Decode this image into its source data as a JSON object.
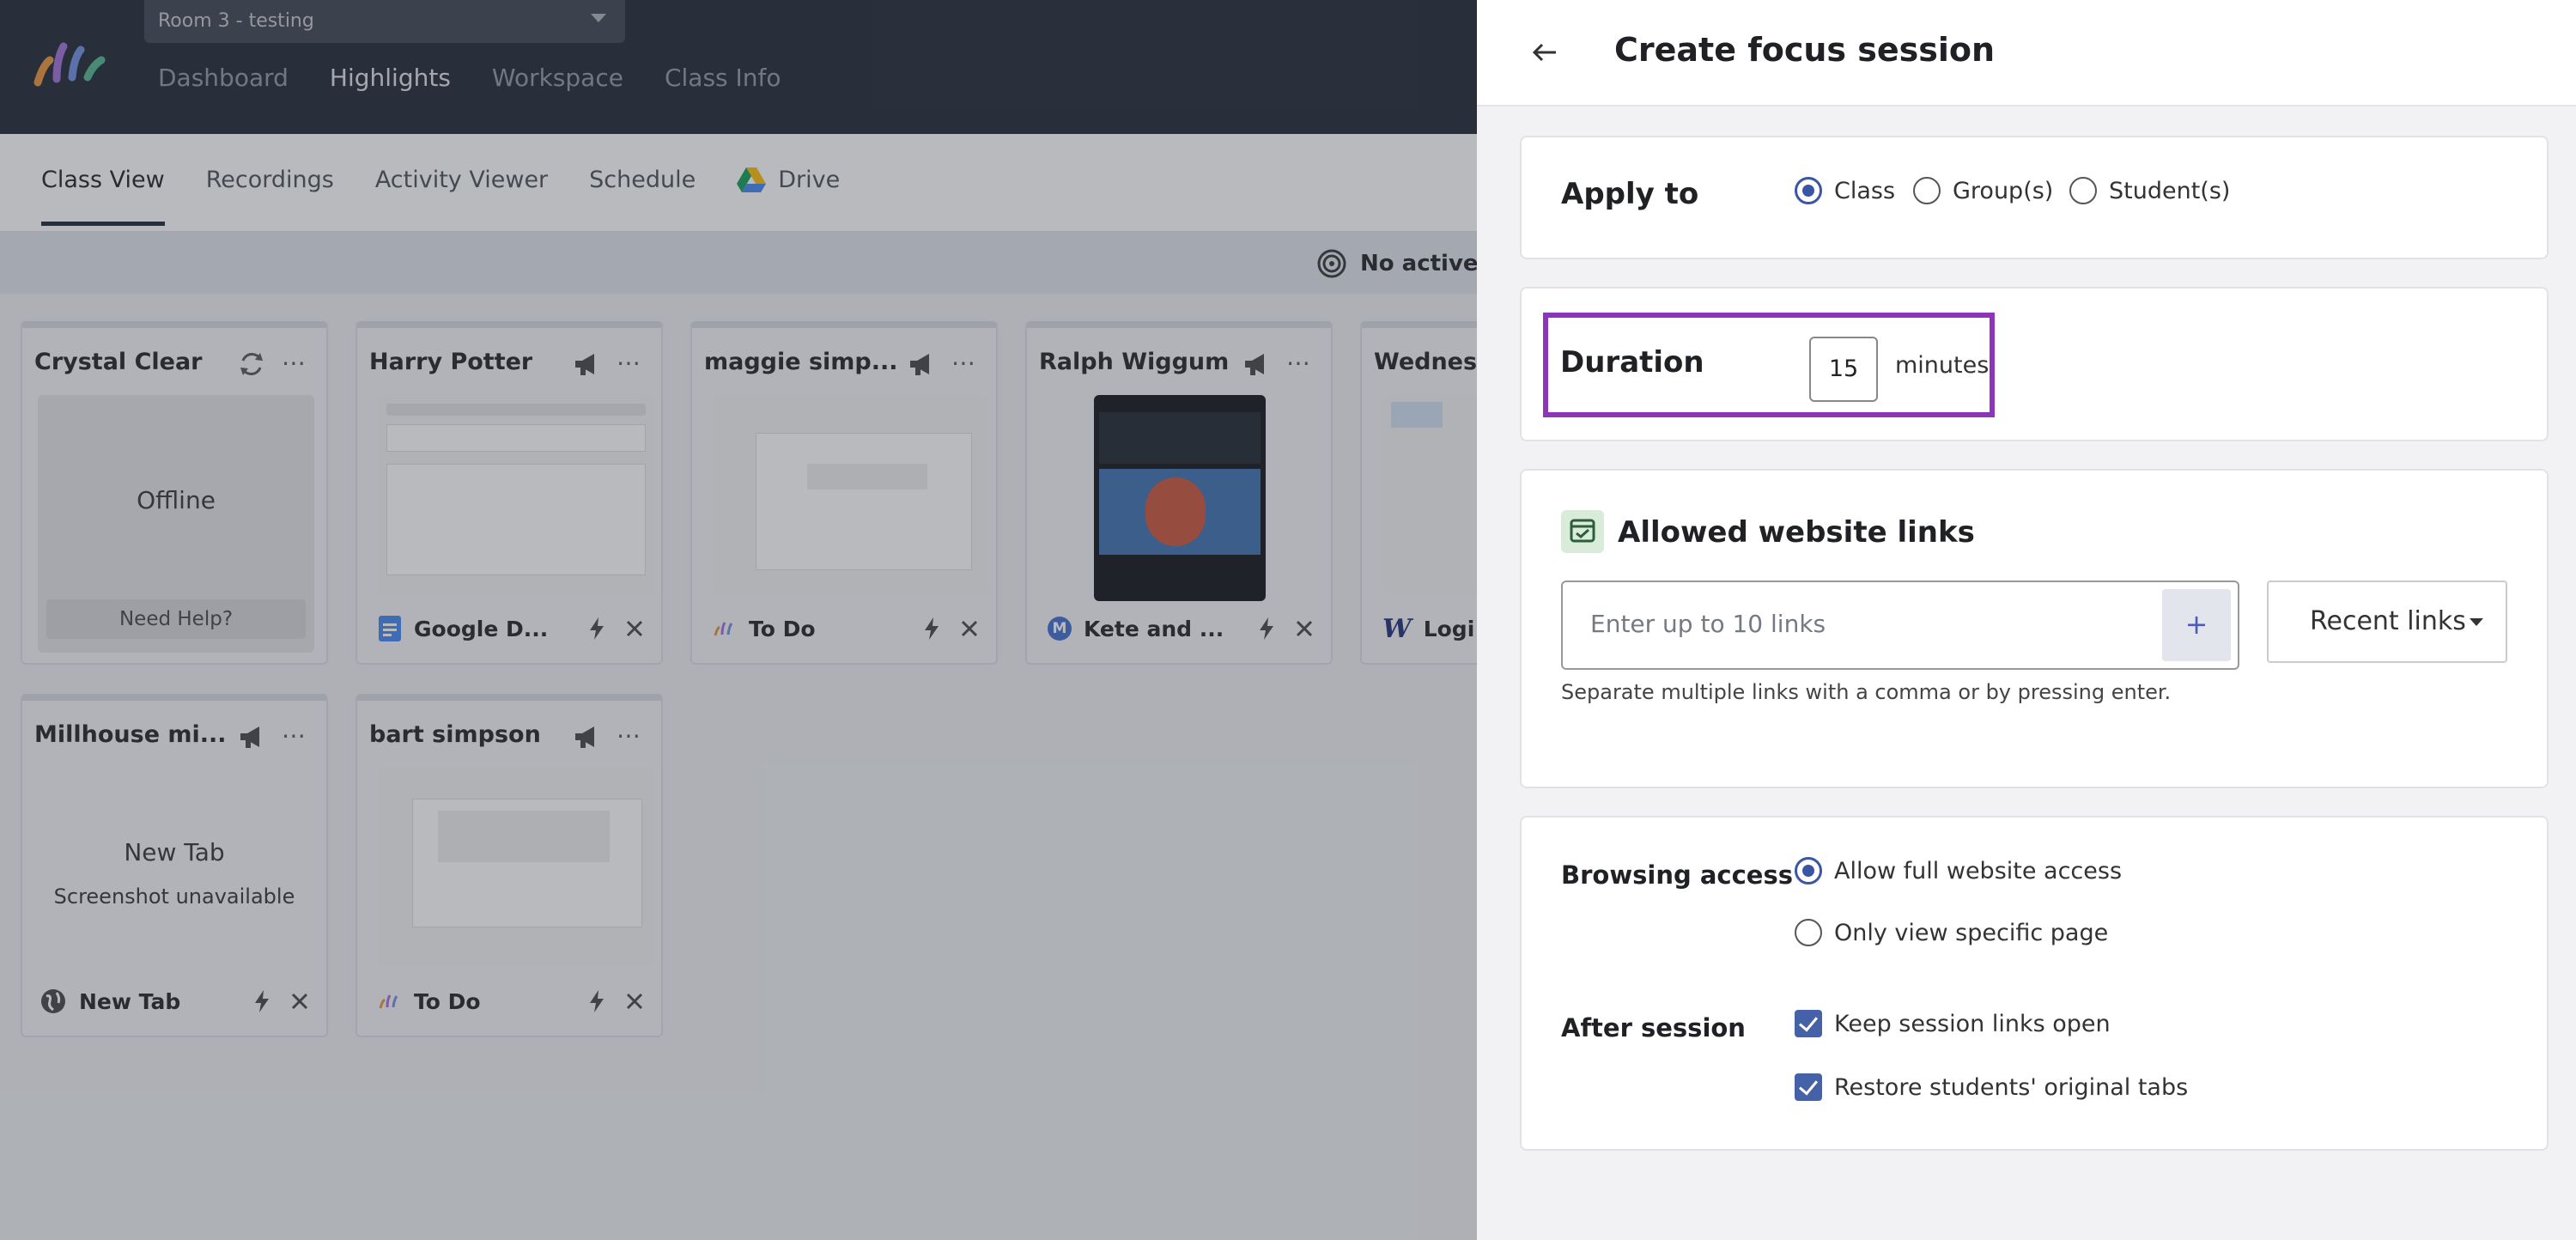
{
  "topbar": {
    "room_select": "Room 3 - testing",
    "nav": [
      "Dashboard",
      "Highlights",
      "Workspace",
      "Class Info"
    ],
    "active_nav": "Highlights"
  },
  "subnav": {
    "tabs": [
      "Class View",
      "Recordings",
      "Activity Viewer",
      "Schedule",
      "Drive"
    ],
    "active_tab": "Class View"
  },
  "status": {
    "text": "No active se"
  },
  "cards": [
    {
      "name": "Crystal Clear",
      "state": "Offline",
      "help": "Need Help?"
    },
    {
      "name": "Harry Potter",
      "tab_title": "Google D..."
    },
    {
      "name": "maggie simp...",
      "tab_title": "To Do"
    },
    {
      "name": "Ralph Wiggum",
      "tab_title": "Kete and ...",
      "tab_badge": "M"
    },
    {
      "name": "Wednesd",
      "tab_title": "Logi",
      "tab_badge": "W"
    },
    {
      "name": "Millhouse mi...",
      "page_title": "New Tab",
      "page_note": "Screenshot unavailable",
      "tab_title": "New Tab"
    },
    {
      "name": "bart simpson",
      "tab_title": "To Do"
    }
  ],
  "panel": {
    "title": "Create focus session",
    "apply_to": {
      "label": "Apply to",
      "options": [
        "Class",
        "Group(s)",
        "Student(s)"
      ],
      "selected": "Class"
    },
    "duration": {
      "label": "Duration",
      "value": "15",
      "unit": "minutes"
    },
    "allowed": {
      "label": "Allowed website links",
      "placeholder": "Enter up to 10 links",
      "add_glyph": "+",
      "recent_label": "Recent links",
      "helper": "Separate multiple links with a comma or by pressing enter."
    },
    "browsing": {
      "label": "Browsing access",
      "options": [
        "Allow full website access",
        "Only view specific page"
      ],
      "selected": "Allow full website access"
    },
    "after": {
      "label": "After session",
      "options": [
        "Keep session links open",
        "Restore students' original tabs"
      ],
      "checked": [
        true,
        true
      ]
    }
  },
  "colors": {
    "accent": "#3a55a6",
    "highlight": "#8b35b8",
    "topbar": "#1f2733"
  }
}
